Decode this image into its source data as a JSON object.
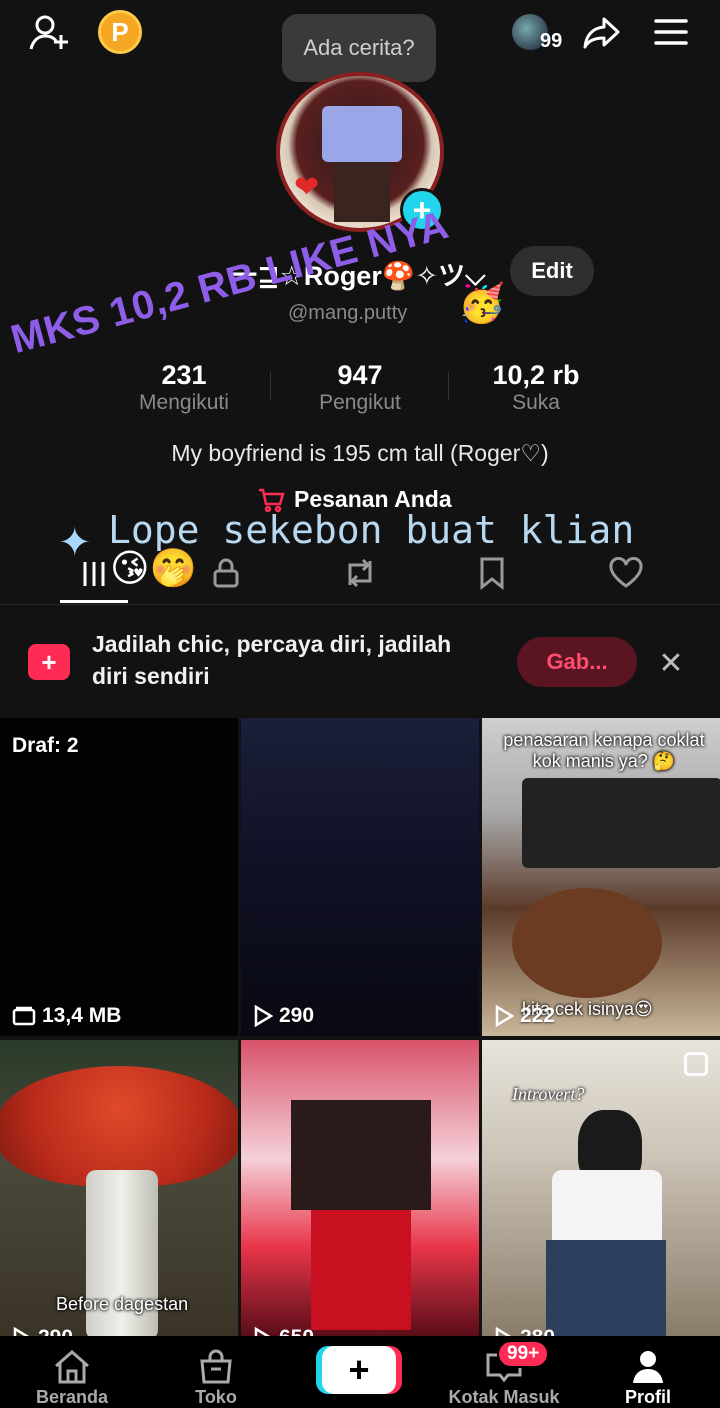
{
  "header": {
    "coin_label": "P",
    "story_prompt": "Ada cerita?",
    "viewer_count": "99"
  },
  "profile": {
    "display_name": "一⊒☆Roger🍄✧ツ⌵",
    "edit_label": "Edit",
    "handle": "@mang.putty",
    "party_emoji": "🥳",
    "stats": [
      {
        "value": "231",
        "label": "Mengikuti"
      },
      {
        "value": "947",
        "label": "Pengikut"
      },
      {
        "value": "10,2 rb",
        "label": "Suka"
      }
    ],
    "bio": "My boyfriend is 195 cm tall (Roger♡)",
    "orders_label": "Pesanan Anda"
  },
  "overlays": {
    "diagonal_text": "MKS 10,2 RB LIKE NYA",
    "lope_text": "Lope sekebon buat klian",
    "emojis": "😘🤭"
  },
  "promo": {
    "text": "Jadilah chic, percaya diri, jadilah diri sendiri",
    "button_label": "Gab..."
  },
  "grid": [
    {
      "label": "Draf: 2",
      "footer": "13,4 MB"
    },
    {
      "footer": "290"
    },
    {
      "caption_top": "penasaran kenapa coklat kok manis ya? 🤔",
      "caption_bottom": "kita cek isinya😍",
      "footer": "222"
    },
    {
      "caption_bottom": "Before dagestan",
      "footer": "290"
    },
    {
      "footer": "650"
    },
    {
      "caption_top": "Introvert?",
      "footer": "280"
    }
  ],
  "nav": {
    "items": [
      {
        "label": "Beranda",
        "icon": "home-icon"
      },
      {
        "label": "Toko",
        "icon": "shop-icon"
      },
      {
        "label": "",
        "icon": "plus-icon"
      },
      {
        "label": "Kotak Masuk",
        "icon": "inbox-icon"
      },
      {
        "label": "Profil",
        "icon": "profile-icon"
      }
    ],
    "inbox_badge": "99+"
  },
  "colors": {
    "accent_cyan": "#20d5ec",
    "accent_red": "#fe2c55",
    "overlay_purple": "#8f5ee8"
  }
}
